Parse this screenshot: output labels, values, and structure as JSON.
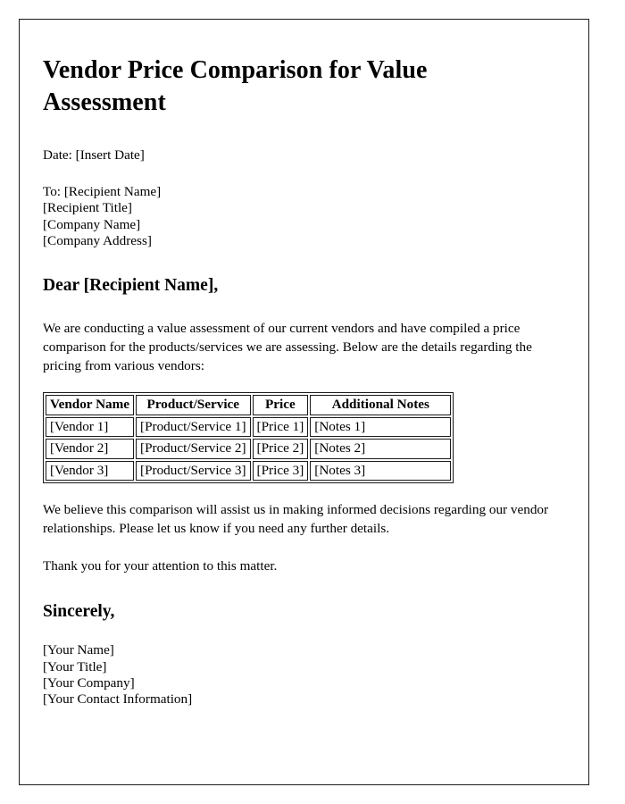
{
  "document": {
    "title": "Vendor Price Comparison for Value Assessment",
    "date_line": "Date: [Insert Date]",
    "recipient": {
      "to_line": "To: [Recipient Name]",
      "title_line": "[Recipient Title]",
      "company_line": "[Company Name]",
      "address_line": "[Company Address]"
    },
    "salutation": "Dear [Recipient Name],",
    "body_paragraph_1": "We are conducting a value assessment of our current vendors and have compiled a price comparison for the products/services we are assessing. Below are the details regarding the pricing from various vendors:",
    "body_paragraph_2": "We believe this comparison will assist us in making informed decisions regarding our vendor relationships. Please let us know if you need any further details.",
    "body_paragraph_3": "Thank you for your attention to this matter.",
    "closing": "Sincerely,",
    "signature": {
      "name_line": "[Your Name]",
      "title_line": "[Your Title]",
      "company_line": "[Your Company]",
      "contact_line": "[Your Contact Information]"
    }
  },
  "comparison_table": {
    "headers": {
      "vendor_name": "Vendor Name",
      "product_service": "Product/Service",
      "price": "Price",
      "additional_notes": "Additional Notes"
    },
    "rows": [
      {
        "vendor_name": "[Vendor 1]",
        "product_service": "[Product/Service 1]",
        "price": "[Price 1]",
        "additional_notes": "[Notes 1]"
      },
      {
        "vendor_name": "[Vendor 2]",
        "product_service": "[Product/Service 2]",
        "price": "[Price 2]",
        "additional_notes": "[Notes 2]"
      },
      {
        "vendor_name": "[Vendor 3]",
        "product_service": "[Product/Service 3]",
        "price": "[Price 3]",
        "additional_notes": "[Notes 3]"
      }
    ]
  },
  "colors": {
    "page_border": "#1a1a1a",
    "text": "#000000",
    "table_border": "#1a1a1a",
    "background": "#ffffff"
  }
}
